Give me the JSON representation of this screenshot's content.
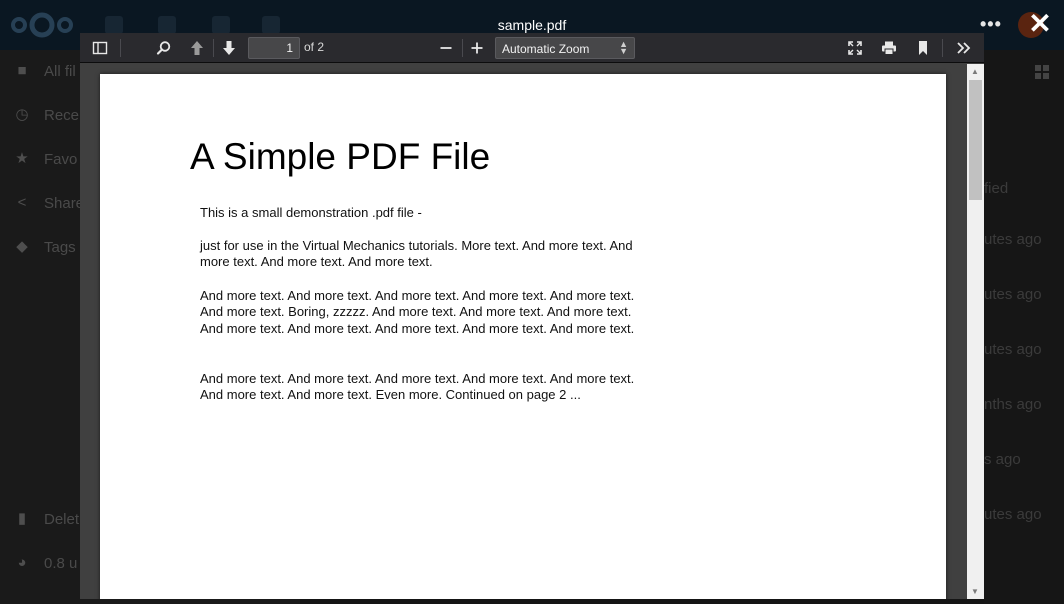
{
  "viewer": {
    "file_name": "sample.pdf",
    "toolbar": {
      "current_page": "1",
      "page_count_label": "of 2",
      "zoom_value": "Automatic Zoom"
    },
    "document": {
      "title": "A Simple PDF File",
      "paragraphs": [
        "This is a small demonstration .pdf file -",
        "just for use in the Virtual Mechanics tutorials. More text. And more text. And more text. And more text. And more text.",
        "And more text. And more text. And more text. And more text. And more text. And more text. Boring, zzzzz. And more text. And more text. And more text. And more text. And more text. And more text. And more text. And more text.",
        "And more text. And more text. And more text. And more text. And more text. And more text. And more text. Even more. Continued on page 2 ..."
      ]
    }
  },
  "background_app": {
    "sidebar": [
      {
        "label": "All fil",
        "icon": "folder-icon"
      },
      {
        "label": "Recen",
        "icon": "clock-icon"
      },
      {
        "label": "Favo",
        "icon": "star-icon"
      },
      {
        "label": "Share",
        "icon": "share-icon"
      },
      {
        "label": "Tags",
        "icon": "tag-icon"
      },
      {
        "label": "Delet",
        "icon": "trash-icon"
      },
      {
        "label": "0.8 u",
        "icon": "pie-icon"
      }
    ],
    "right_column": [
      "fied",
      "utes ago",
      "utes ago",
      "utes ago",
      "nths ago",
      "s ago",
      "utes ago"
    ]
  },
  "colors": {
    "header_bg": "#0a1722",
    "toolbar_bg": "#2a2a2e",
    "viewer_bg": "#404040",
    "page_bg": "#ffffff"
  }
}
